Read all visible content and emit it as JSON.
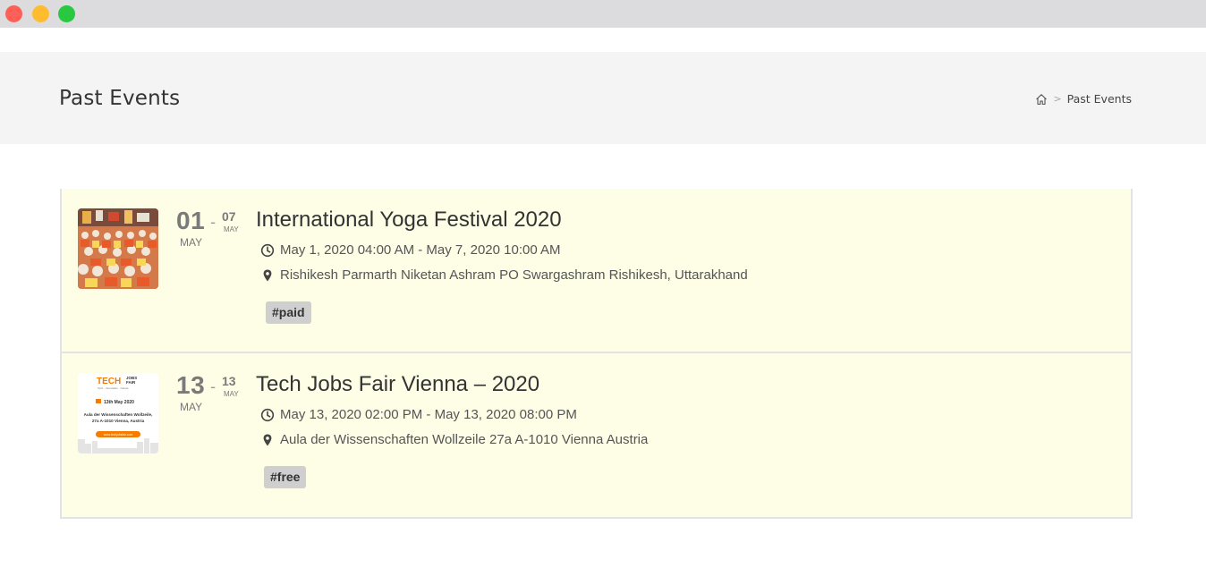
{
  "window": {
    "controls": [
      "close",
      "minimize",
      "maximize"
    ]
  },
  "header": {
    "title": "Past Events",
    "breadcrumb": {
      "separator": ">",
      "current": "Past Events"
    }
  },
  "events": [
    {
      "day_start": "01",
      "dash": "-",
      "day_end": "07",
      "month_end": "MAY",
      "month": "MAY",
      "title": "International Yoga Festival 2020",
      "time": "May 1, 2020 04:00 AM - May 7, 2020 10:00 AM",
      "location": "Rishikesh Parmarth Niketan Ashram PO Swargashram Rishikesh, Uttarakhand",
      "tag": "#paid"
    },
    {
      "day_start": "13",
      "dash": "-",
      "day_end": "13",
      "month_end": "MAY",
      "month": "MAY",
      "title": "Tech Jobs Fair Vienna – 2020",
      "time": "May 13, 2020 02:00 PM - May 13, 2020 08:00 PM",
      "location": "Aula der Wissenschaften Wollzeile 27a A-1010 Vienna Austria",
      "tag": "#free",
      "poster": {
        "brand_top": "TECH",
        "brand_jobs": "JOBS",
        "brand_fair": "FAIR",
        "subtitle": "Tech · Innovation · Career",
        "date": "13th May 2020",
        "venue_line1": "Aula der Wissenschaften Wollzeile,",
        "venue_line2": "27a A-1010 Vienna, Austria",
        "url": "www.techjobsfair.com"
      }
    }
  ],
  "colors": {
    "accent": "#f57c00",
    "row_bg": "#fefee6",
    "header_bg": "#f4f4f4",
    "tag_bg": "#cfcfcf"
  }
}
